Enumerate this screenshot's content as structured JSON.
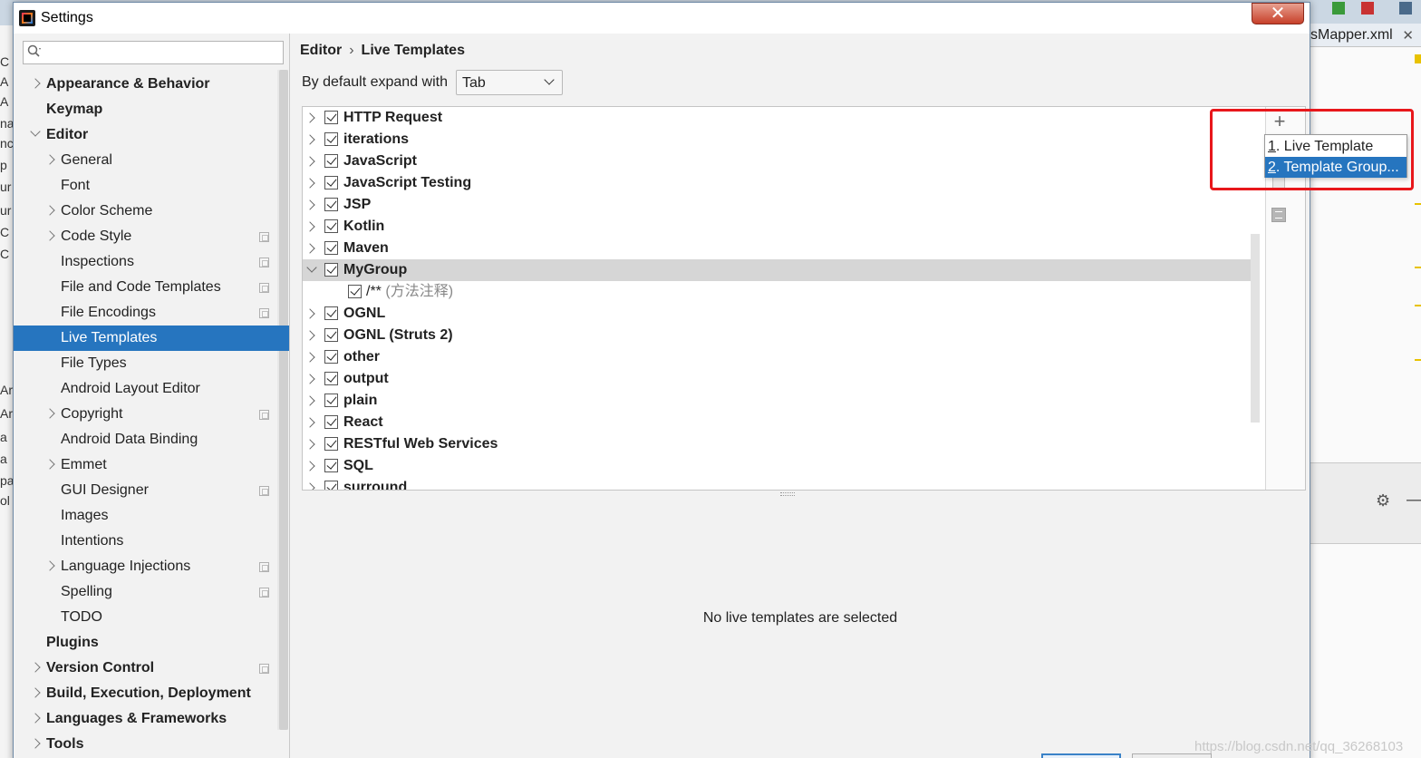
{
  "window": {
    "title": "Settings",
    "close_glyph": "✕"
  },
  "background": {
    "editor_tab": "sMapper.xml",
    "editor_tab_close": "✕",
    "gear_glyph": "⚙",
    "minus_glyph": "—",
    "left_letters": [
      "C",
      "A",
      "A",
      "na",
      "nc",
      "p",
      "ur",
      "ur",
      "C",
      "C",
      "Ar",
      "Ar",
      "a",
      "a",
      "pa",
      "ol"
    ]
  },
  "sidebar": {
    "search_placeholder": "",
    "items": [
      {
        "label": "Appearance & Behavior",
        "level": 0,
        "bold": true,
        "chevron": "right",
        "project_icon": false
      },
      {
        "label": "Keymap",
        "level": 0,
        "bold": true,
        "chevron": "none",
        "project_icon": false
      },
      {
        "label": "Editor",
        "level": 0,
        "bold": true,
        "chevron": "down",
        "project_icon": false
      },
      {
        "label": "General",
        "level": 1,
        "bold": false,
        "chevron": "right",
        "project_icon": false
      },
      {
        "label": "Font",
        "level": 1,
        "bold": false,
        "chevron": "none",
        "project_icon": false
      },
      {
        "label": "Color Scheme",
        "level": 1,
        "bold": false,
        "chevron": "right",
        "project_icon": false
      },
      {
        "label": "Code Style",
        "level": 1,
        "bold": false,
        "chevron": "right",
        "project_icon": true
      },
      {
        "label": "Inspections",
        "level": 1,
        "bold": false,
        "chevron": "none",
        "project_icon": true
      },
      {
        "label": "File and Code Templates",
        "level": 1,
        "bold": false,
        "chevron": "none",
        "project_icon": true
      },
      {
        "label": "File Encodings",
        "level": 1,
        "bold": false,
        "chevron": "none",
        "project_icon": true
      },
      {
        "label": "Live Templates",
        "level": 1,
        "bold": false,
        "chevron": "none",
        "project_icon": false,
        "selected": true
      },
      {
        "label": "File Types",
        "level": 1,
        "bold": false,
        "chevron": "none",
        "project_icon": false
      },
      {
        "label": "Android Layout Editor",
        "level": 1,
        "bold": false,
        "chevron": "none",
        "project_icon": false
      },
      {
        "label": "Copyright",
        "level": 1,
        "bold": false,
        "chevron": "right",
        "project_icon": true
      },
      {
        "label": "Android Data Binding",
        "level": 1,
        "bold": false,
        "chevron": "none",
        "project_icon": false
      },
      {
        "label": "Emmet",
        "level": 1,
        "bold": false,
        "chevron": "right",
        "project_icon": false
      },
      {
        "label": "GUI Designer",
        "level": 1,
        "bold": false,
        "chevron": "none",
        "project_icon": true
      },
      {
        "label": "Images",
        "level": 1,
        "bold": false,
        "chevron": "none",
        "project_icon": false
      },
      {
        "label": "Intentions",
        "level": 1,
        "bold": false,
        "chevron": "none",
        "project_icon": false
      },
      {
        "label": "Language Injections",
        "level": 1,
        "bold": false,
        "chevron": "right",
        "project_icon": true
      },
      {
        "label": "Spelling",
        "level": 1,
        "bold": false,
        "chevron": "none",
        "project_icon": true
      },
      {
        "label": "TODO",
        "level": 1,
        "bold": false,
        "chevron": "none",
        "project_icon": false
      },
      {
        "label": "Plugins",
        "level": 0,
        "bold": true,
        "chevron": "none",
        "project_icon": false
      },
      {
        "label": "Version Control",
        "level": 0,
        "bold": true,
        "chevron": "right",
        "project_icon": true
      },
      {
        "label": "Build, Execution, Deployment",
        "level": 0,
        "bold": true,
        "chevron": "right",
        "project_icon": false
      },
      {
        "label": "Languages & Frameworks",
        "level": 0,
        "bold": true,
        "chevron": "right",
        "project_icon": false
      },
      {
        "label": "Tools",
        "level": 0,
        "bold": true,
        "chevron": "right",
        "project_icon": false
      }
    ]
  },
  "content": {
    "breadcrumb": {
      "parent": "Editor",
      "separator": "›",
      "current": "Live Templates"
    },
    "expand_label": "By default expand with",
    "expand_value": "Tab",
    "groups": [
      {
        "label": "HTTP Request",
        "checked": true,
        "expanded": false
      },
      {
        "label": "iterations",
        "checked": true,
        "expanded": false
      },
      {
        "label": "JavaScript",
        "checked": true,
        "expanded": false
      },
      {
        "label": "JavaScript Testing",
        "checked": true,
        "expanded": false
      },
      {
        "label": "JSP",
        "checked": true,
        "expanded": false
      },
      {
        "label": "Kotlin",
        "checked": true,
        "expanded": false
      },
      {
        "label": "Maven",
        "checked": true,
        "expanded": false
      },
      {
        "label": "MyGroup",
        "checked": true,
        "expanded": true,
        "selected": true
      },
      {
        "label": "/**",
        "description": "(方法注释)",
        "checked": true,
        "child": true
      },
      {
        "label": "OGNL",
        "checked": true,
        "expanded": false
      },
      {
        "label": "OGNL (Struts 2)",
        "checked": true,
        "expanded": false
      },
      {
        "label": "other",
        "checked": true,
        "expanded": false
      },
      {
        "label": "output",
        "checked": true,
        "expanded": false
      },
      {
        "label": "plain",
        "checked": true,
        "expanded": false
      },
      {
        "label": "React",
        "checked": true,
        "expanded": false
      },
      {
        "label": "RESTful Web Services",
        "checked": true,
        "expanded": false
      },
      {
        "label": "SQL",
        "checked": true,
        "expanded": false
      },
      {
        "label": "surround",
        "checked": true,
        "expanded": false
      }
    ],
    "toolbar": {
      "add_glyph": "+"
    },
    "empty_message": "No live templates are selected"
  },
  "popup": {
    "items": [
      {
        "number": "1",
        "label": ". Live Template",
        "active": false
      },
      {
        "number": "2",
        "label": ". Template Group...",
        "active": true
      }
    ]
  },
  "colors": {
    "selection": "#2675bf",
    "highlight_box": "#e8171b",
    "close_button": "#c7402a"
  },
  "watermark": "https://blog.csdn.net/qq_36268103"
}
